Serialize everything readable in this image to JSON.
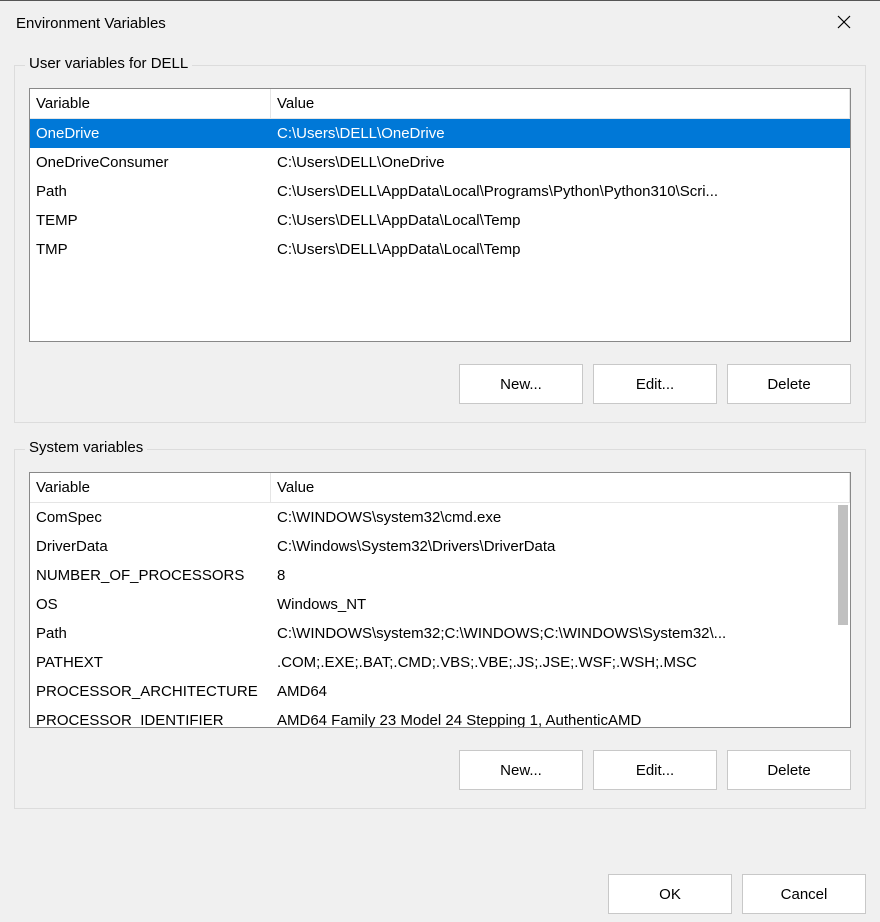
{
  "title": "Environment Variables",
  "userGroup": {
    "legend": "User variables for DELL",
    "columns": {
      "variable": "Variable",
      "value": "Value"
    },
    "rows": [
      {
        "variable": "OneDrive",
        "value": "C:\\Users\\DELL\\OneDrive",
        "selected": true
      },
      {
        "variable": "OneDriveConsumer",
        "value": "C:\\Users\\DELL\\OneDrive"
      },
      {
        "variable": "Path",
        "value": "C:\\Users\\DELL\\AppData\\Local\\Programs\\Python\\Python310\\Scri..."
      },
      {
        "variable": "TEMP",
        "value": "C:\\Users\\DELL\\AppData\\Local\\Temp"
      },
      {
        "variable": "TMP",
        "value": "C:\\Users\\DELL\\AppData\\Local\\Temp"
      }
    ],
    "buttons": {
      "new": "New...",
      "edit": "Edit...",
      "delete": "Delete"
    }
  },
  "systemGroup": {
    "legend": "System variables",
    "columns": {
      "variable": "Variable",
      "value": "Value"
    },
    "rows": [
      {
        "variable": "ComSpec",
        "value": "C:\\WINDOWS\\system32\\cmd.exe"
      },
      {
        "variable": "DriverData",
        "value": "C:\\Windows\\System32\\Drivers\\DriverData"
      },
      {
        "variable": "NUMBER_OF_PROCESSORS",
        "value": "8"
      },
      {
        "variable": "OS",
        "value": "Windows_NT"
      },
      {
        "variable": "Path",
        "value": "C:\\WINDOWS\\system32;C:\\WINDOWS;C:\\WINDOWS\\System32\\..."
      },
      {
        "variable": "PATHEXT",
        "value": ".COM;.EXE;.BAT;.CMD;.VBS;.VBE;.JS;.JSE;.WSF;.WSH;.MSC"
      },
      {
        "variable": "PROCESSOR_ARCHITECTURE",
        "value": "AMD64"
      },
      {
        "variable": "PROCESSOR_IDENTIFIER",
        "value": "AMD64 Family 23 Model 24 Stepping 1, AuthenticAMD"
      }
    ],
    "buttons": {
      "new": "New...",
      "edit": "Edit...",
      "delete": "Delete"
    }
  },
  "dialogButtons": {
    "ok": "OK",
    "cancel": "Cancel"
  }
}
